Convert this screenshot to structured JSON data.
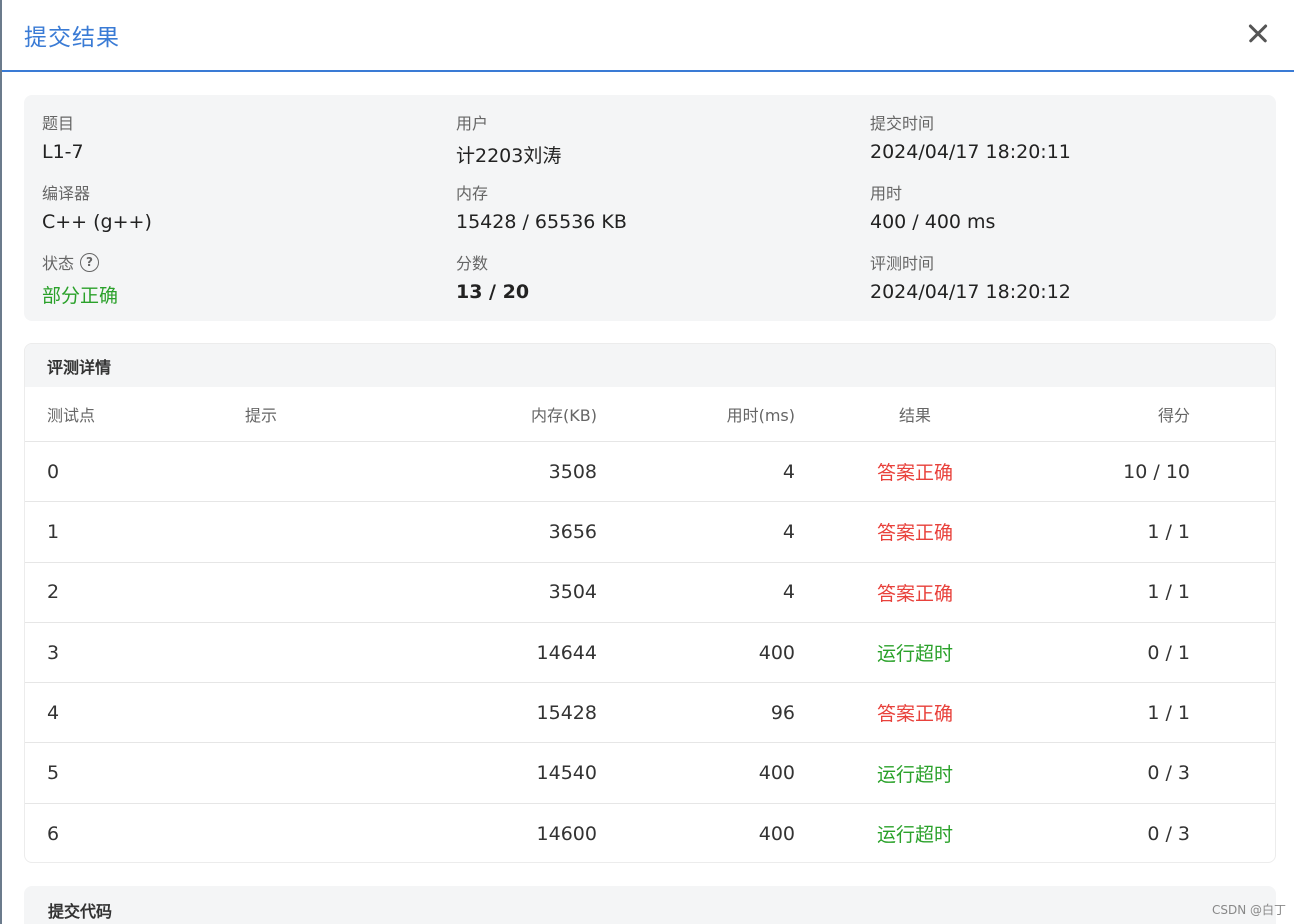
{
  "dialog": {
    "title": "提交结果"
  },
  "summary": {
    "problem_label": "题目",
    "problem_value": "L1-7",
    "user_label": "用户",
    "user_value": "计2203刘涛",
    "submit_time_label": "提交时间",
    "submit_time_value": "2024/04/17 18:20:11",
    "compiler_label": "编译器",
    "compiler_value": "C++ (g++)",
    "memory_label": "内存",
    "memory_value": "15428 / 65536 KB",
    "time_label": "用时",
    "time_value": "400 / 400 ms",
    "status_label": "状态",
    "status_value": "部分正确",
    "score_label": "分数",
    "score_value": "13 / 20",
    "judge_time_label": "评测时间",
    "judge_time_value": "2024/04/17 18:20:12",
    "help_icon": "question-circle-icon"
  },
  "details": {
    "title": "评测详情",
    "columns": [
      "测试点",
      "提示",
      "内存(KB)",
      "用时(ms)",
      "结果",
      "得分"
    ],
    "rows": [
      {
        "id": "0",
        "tip": "",
        "memory": "3508",
        "time": "4",
        "result": "答案正确",
        "score": "10 / 10"
      },
      {
        "id": "1",
        "tip": "",
        "memory": "3656",
        "time": "4",
        "result": "答案正确",
        "score": "1 / 1"
      },
      {
        "id": "2",
        "tip": "",
        "memory": "3504",
        "time": "4",
        "result": "答案正确",
        "score": "1 / 1"
      },
      {
        "id": "3",
        "tip": "",
        "memory": "14644",
        "time": "400",
        "result": "运行超时",
        "score": "0 / 1"
      },
      {
        "id": "4",
        "tip": "",
        "memory": "15428",
        "time": "96",
        "result": "答案正确",
        "score": "1 / 1"
      },
      {
        "id": "5",
        "tip": "",
        "memory": "14540",
        "time": "400",
        "result": "运行超时",
        "score": "0 / 3"
      },
      {
        "id": "6",
        "tip": "",
        "memory": "14600",
        "time": "400",
        "result": "运行超时",
        "score": "0 / 3"
      }
    ]
  },
  "code": {
    "title": "提交代码"
  },
  "watermark": "CSDN @白丁",
  "colors": {
    "accent": "#3a7bd5",
    "correct": "#e8413b",
    "timeout": "#2aa12a",
    "partial": "#2aa12a"
  }
}
